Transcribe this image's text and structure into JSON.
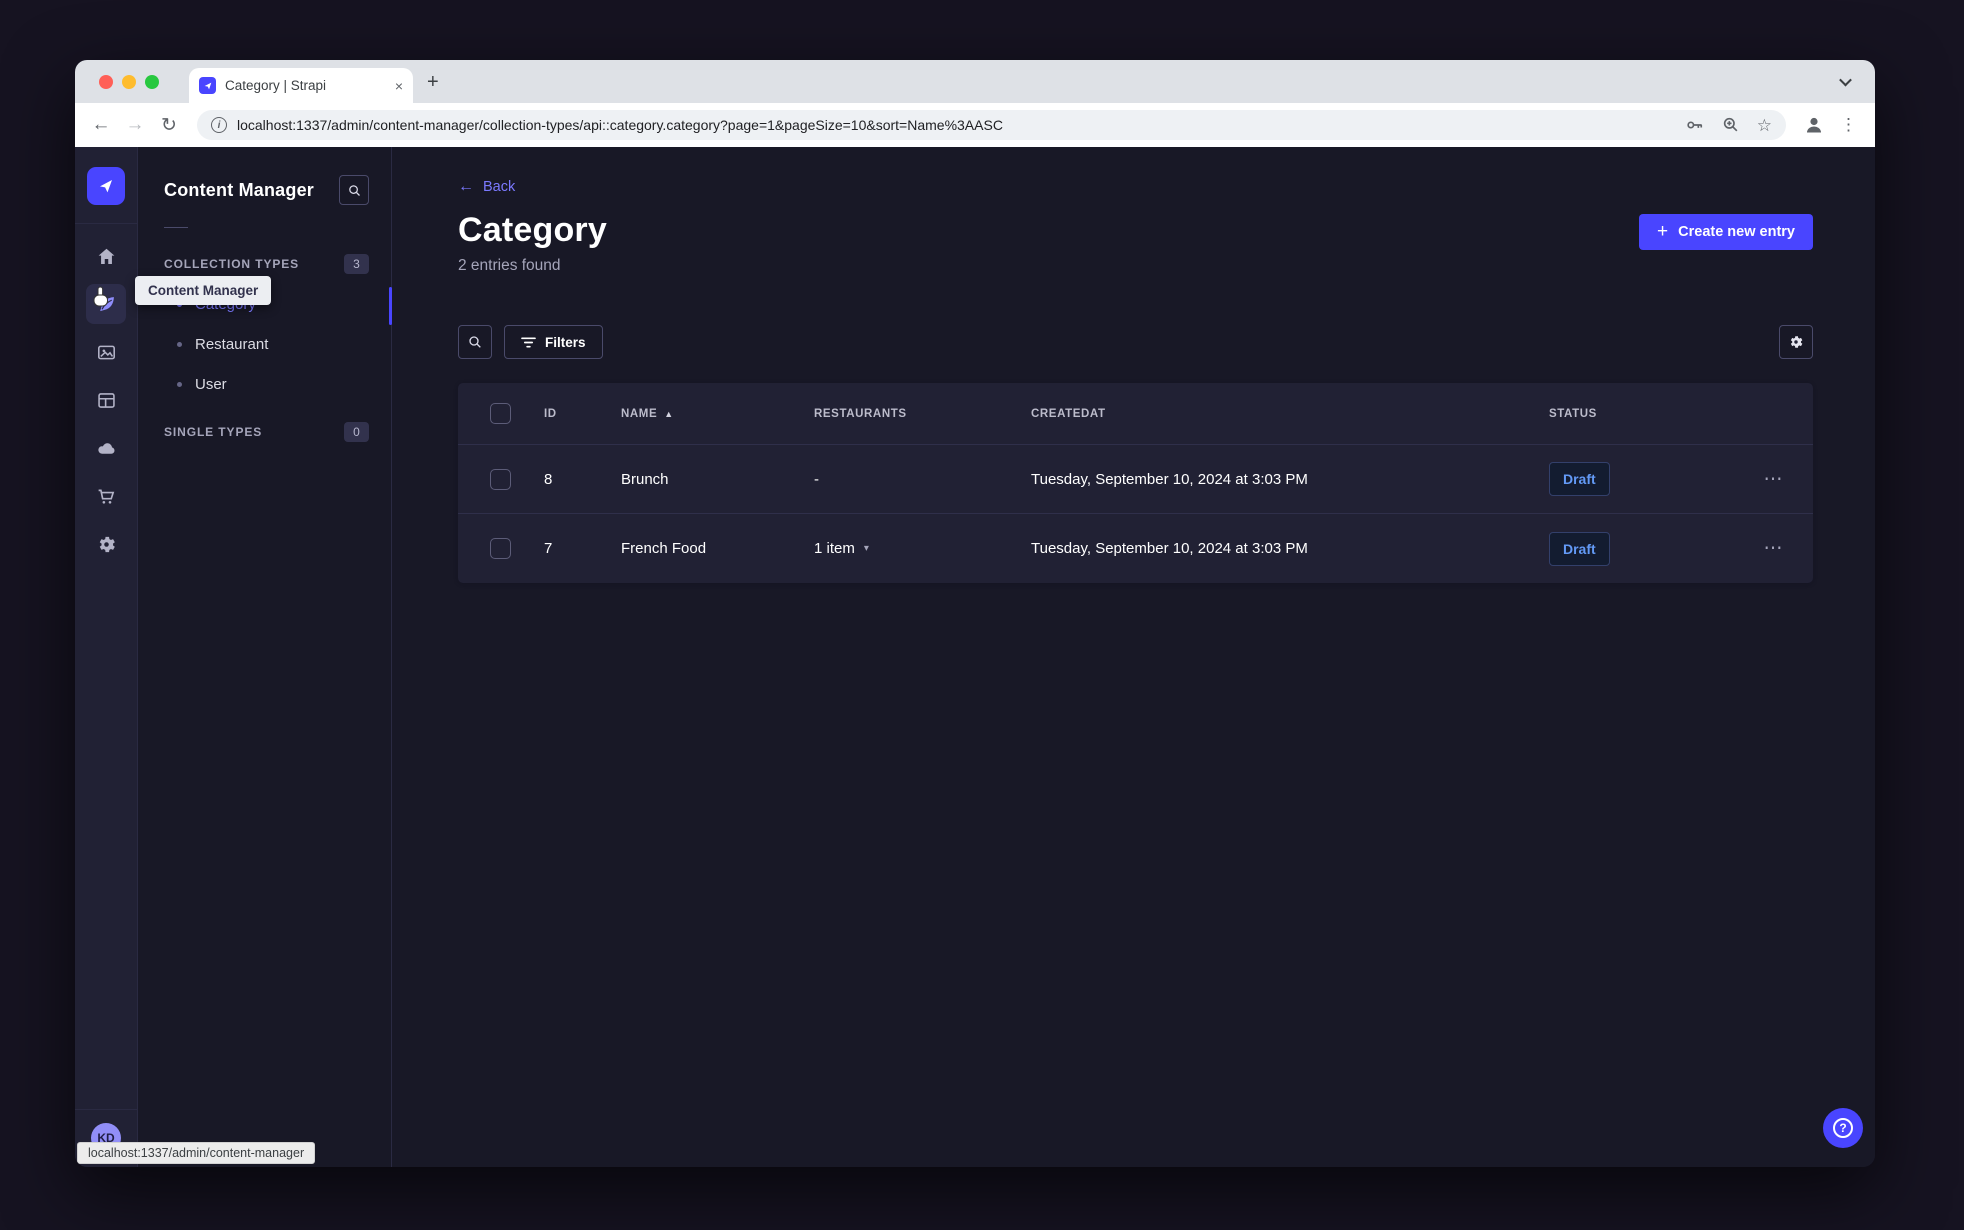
{
  "colors": {
    "accent": "#4945ff",
    "link": "#7b79ff",
    "draft_text": "#639af6",
    "rail_bg": "#212134",
    "app_bg": "#181826",
    "chrome_bg": "#dee1e6"
  },
  "browser": {
    "tab": {
      "title": "Category | Strapi",
      "close_glyph": "×"
    },
    "new_tab_glyph": "+",
    "nav": {
      "back_glyph": "←",
      "forward_glyph": "→",
      "reload_glyph": "↻"
    },
    "info_glyph": "i",
    "url": "localhost:1337/admin/content-manager/collection-types/api::category.category?page=1&pageSize=10&sort=Name%3AASC",
    "star_glyph": "☆",
    "kebab_glyph": "⋮"
  },
  "rail": {
    "icon_names": [
      "strapi-logo",
      "home-icon",
      "content-manager-icon",
      "media-library-icon",
      "content-type-builder-icon",
      "cloud-icon",
      "marketplace-cart-icon",
      "settings-gear-icon"
    ],
    "avatar_initials": "KD"
  },
  "subnav": {
    "title": "Content Manager",
    "sections": [
      {
        "label": "COLLECTION TYPES",
        "badge": "3",
        "items": [
          {
            "label": "Category",
            "active": true
          },
          {
            "label": "Restaurant",
            "active": false
          },
          {
            "label": "User",
            "active": false
          }
        ]
      },
      {
        "label": "SINGLE TYPES",
        "badge": "0",
        "items": []
      }
    ]
  },
  "tooltip": {
    "text": "Content Manager"
  },
  "main": {
    "back_label": "Back",
    "back_glyph": "←",
    "title": "Category",
    "subtitle": "2 entries found",
    "create_button": "Create new entry",
    "plus_glyph": "+",
    "filters_button": "Filters"
  },
  "table": {
    "headers": {
      "id": "ID",
      "name": "NAME",
      "restaurants": "RESTAURANTS",
      "createdat": "CREATEDAT",
      "status": "STATUS"
    },
    "sort_glyph": "▲",
    "caret_glyph": "▾",
    "actions_glyph": "⋯",
    "rows": [
      {
        "id": "8",
        "name": "Brunch",
        "restaurants": "-",
        "createdat": "Tuesday, September 10, 2024 at 3:03 PM",
        "status": "Draft"
      },
      {
        "id": "7",
        "name": "French Food",
        "restaurants": "1 item",
        "createdat": "Tuesday, September 10, 2024 at 3:03 PM",
        "status": "Draft"
      }
    ]
  },
  "status_bar": {
    "text": "localhost:1337/admin/content-manager"
  },
  "help": {
    "glyph": "?"
  }
}
